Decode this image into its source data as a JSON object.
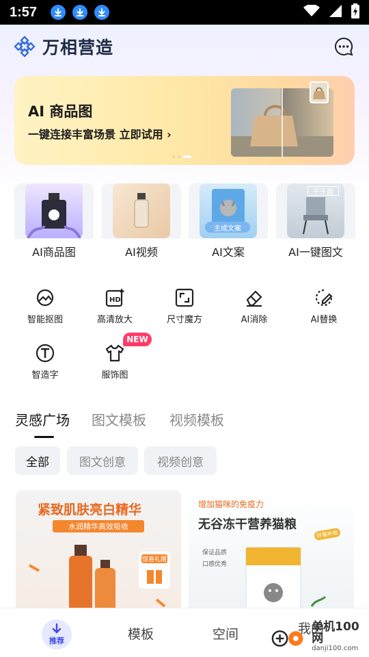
{
  "status_bar": {
    "time": "1:57"
  },
  "header": {
    "app_title": "万相营造"
  },
  "banner": {
    "title": "AI 商品图",
    "subtitle": "一键连接丰富场景 立即试用 ›"
  },
  "feature_cards": [
    {
      "label": "AI商品图",
      "color": "#b9b0ff"
    },
    {
      "label": "AI视频",
      "color": "#f2dcc2"
    },
    {
      "label": "AI文案",
      "color": "#bfe0f5",
      "overlay": "主成文案"
    },
    {
      "label": "AI一键图文",
      "color": "#cdd5dd",
      "overlay": "千千面"
    }
  ],
  "tools_row1": [
    {
      "label": "智能抠图",
      "icon": "smart-cutout-icon"
    },
    {
      "label": "高清放大",
      "icon": "hd-upscale-icon"
    },
    {
      "label": "尺寸魔方",
      "icon": "resize-icon"
    },
    {
      "label": "AI消除",
      "icon": "eraser-icon"
    },
    {
      "label": "AI替换",
      "icon": "replace-icon"
    }
  ],
  "tools_row2": [
    {
      "label": "智造字",
      "icon": "text-t-icon"
    },
    {
      "label": "服饰图",
      "icon": "tshirt-icon"
    }
  ],
  "new_badge": "NEW",
  "section_tabs": [
    "灵感广场",
    "图文模板",
    "视频模板"
  ],
  "chips": [
    "全部",
    "图文创意",
    "视频创意"
  ],
  "tiles": [
    {
      "title": "紧致肌肤亮白精华",
      "pill": "水润精华高效吸收",
      "badge": "惊喜礼赠"
    },
    {
      "subtitle": "增加猫咪的免疫力",
      "title": "无谷冻干营养猫粮",
      "tag": "好猫补给",
      "points": [
        "保证品质",
        "口感优秀"
      ]
    }
  ],
  "bottom_nav": {
    "home": "推荐",
    "templates": "模板",
    "space": "空间",
    "mine": "我的"
  },
  "watermark": {
    "name": "单机100网",
    "url": "danji100.com"
  },
  "colors": {
    "accent": "#3d4ae8",
    "badge": "#ff3d6b",
    "orange": "#f4862e"
  }
}
